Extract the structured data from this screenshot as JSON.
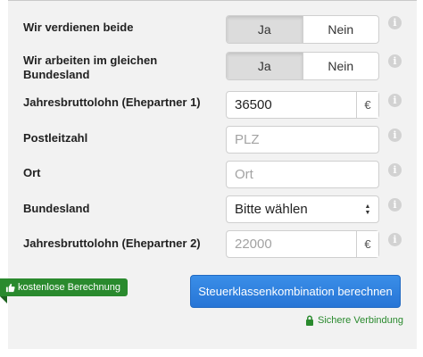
{
  "rows": {
    "both_earn": {
      "label": "Wir verdienen beide",
      "yes": "Ja",
      "no": "Nein",
      "selected": "yes"
    },
    "same_state": {
      "label": "Wir arbeiten im gleichen Bundesland",
      "yes": "Ja",
      "no": "Nein",
      "selected": "yes"
    },
    "salary1": {
      "label": "Jahresbruttolohn (Ehepartner 1)",
      "value": "36500",
      "unit": "€"
    },
    "zip": {
      "label": "Postleitzahl",
      "placeholder": "PLZ"
    },
    "city": {
      "label": "Ort",
      "placeholder": "Ort"
    },
    "state": {
      "label": "Bundesland",
      "selected": "Bitte wählen"
    },
    "salary2": {
      "label": "Jahresbruttolohn (Ehepartner 2)",
      "placeholder": "22000",
      "unit": "€"
    }
  },
  "info_glyph": "i",
  "badge": {
    "icon": "thumbs-up-icon",
    "label": "kostenlose Berechnung"
  },
  "cta": {
    "label": "Steuerklassenkombination berechnen"
  },
  "secure": {
    "icon": "lock-icon",
    "label": "Sichere Verbindung"
  },
  "colors": {
    "green": "#2a8a2e",
    "blue": "#2b7ddc",
    "panel": "#f2f2f2"
  }
}
